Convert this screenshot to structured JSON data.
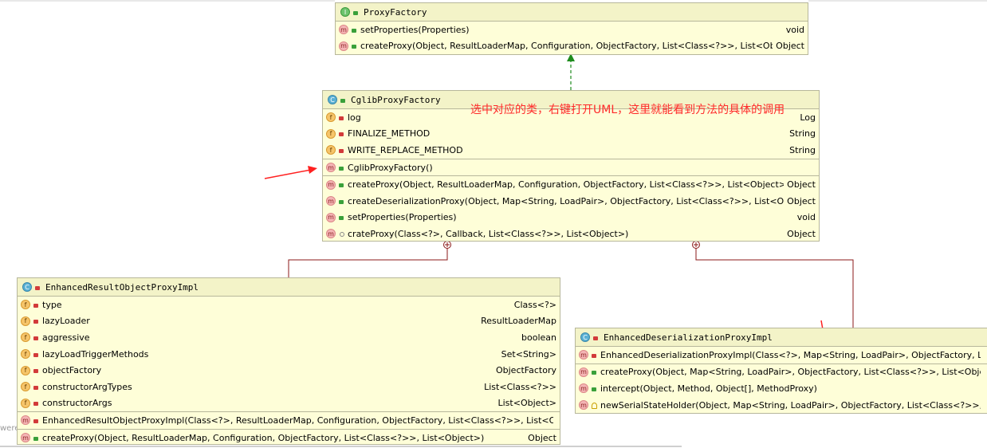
{
  "annotation": "选中对应的类，右键打开UML，这里就能看到方法的具体的调用",
  "left_fragment": "were",
  "classes": {
    "proxy_factory": {
      "name": "ProxyFactory",
      "kind": "I",
      "methods": [
        {
          "sig": "setProperties(Properties)",
          "type": "void",
          "vis": "pub"
        },
        {
          "sig": "createProxy(Object, ResultLoaderMap, Configuration, ObjectFactory, List<Class<?>>, List<Object>)",
          "type": "Object",
          "vis": "pub"
        }
      ]
    },
    "cglib": {
      "name": "CglibProxyFactory",
      "kind": "C",
      "fields": [
        {
          "sig": "log",
          "type": "Log",
          "vis": "priv"
        },
        {
          "sig": "FINALIZE_METHOD",
          "type": "String",
          "vis": "priv"
        },
        {
          "sig": "WRITE_REPLACE_METHOD",
          "type": "String",
          "vis": "priv"
        }
      ],
      "constructors": [
        {
          "sig": "CglibProxyFactory()",
          "type": "",
          "vis": "pub"
        }
      ],
      "methods": [
        {
          "sig": "createProxy(Object, ResultLoaderMap, Configuration, ObjectFactory, List<Class<?>>, List<Object>)",
          "type": "Object",
          "vis": "pub"
        },
        {
          "sig": "createDeserializationProxy(Object, Map<String, LoadPair>, ObjectFactory, List<Class<?>>, List<Object>)",
          "type": "Object",
          "vis": "pub"
        },
        {
          "sig": "setProperties(Properties)",
          "type": "void",
          "vis": "pub"
        },
        {
          "sig": "crateProxy(Class<?>, Callback, List<Class<?>>, List<Object>)",
          "type": "Object",
          "vis": "pkg"
        }
      ]
    },
    "enhanced_result": {
      "name": "EnhancedResultObjectProxyImpl",
      "kind": "C",
      "fields": [
        {
          "sig": "type",
          "type": "Class<?>",
          "vis": "priv"
        },
        {
          "sig": "lazyLoader",
          "type": "ResultLoaderMap",
          "vis": "priv"
        },
        {
          "sig": "aggressive",
          "type": "boolean",
          "vis": "priv"
        },
        {
          "sig": "lazyLoadTriggerMethods",
          "type": "Set<String>",
          "vis": "priv"
        },
        {
          "sig": "objectFactory",
          "type": "ObjectFactory",
          "vis": "priv"
        },
        {
          "sig": "constructorArgTypes",
          "type": "List<Class<?>>",
          "vis": "priv"
        },
        {
          "sig": "constructorArgs",
          "type": "List<Object>",
          "vis": "priv"
        }
      ],
      "constructors": [
        {
          "sig": "EnhancedResultObjectProxyImpl(Class<?>, ResultLoaderMap, Configuration, ObjectFactory, List<Class<?>>, List<Object>)",
          "type": "",
          "vis": "priv"
        }
      ],
      "methods": [
        {
          "sig": "createProxy(Object, ResultLoaderMap, Configuration, ObjectFactory, List<Class<?>>, List<Object>)",
          "type": "Object",
          "vis": "pub"
        }
      ]
    },
    "enhanced_deser": {
      "name": "EnhancedDeserializationProxyImpl",
      "kind": "C",
      "constructors": [
        {
          "sig": "EnhancedDeserializationProxyImpl(Class<?>, Map<String, LoadPair>, ObjectFactory, List<Class<?>>, List<Object>)",
          "type": "",
          "vis": "priv"
        }
      ],
      "methods": [
        {
          "sig": "createProxy(Object, Map<String, LoadPair>, ObjectFactory, List<Class<?>>, List<Object>)",
          "type": "",
          "vis": "pub"
        },
        {
          "sig": "intercept(Object, Method, Object[], MethodProxy)",
          "type": "",
          "vis": "pub"
        },
        {
          "sig": "newSerialStateHolder(Object, Map<String, LoadPair>, ObjectFactory, List<Class<?>>, List<Object>)",
          "type": "",
          "vis": "prot"
        }
      ]
    }
  }
}
